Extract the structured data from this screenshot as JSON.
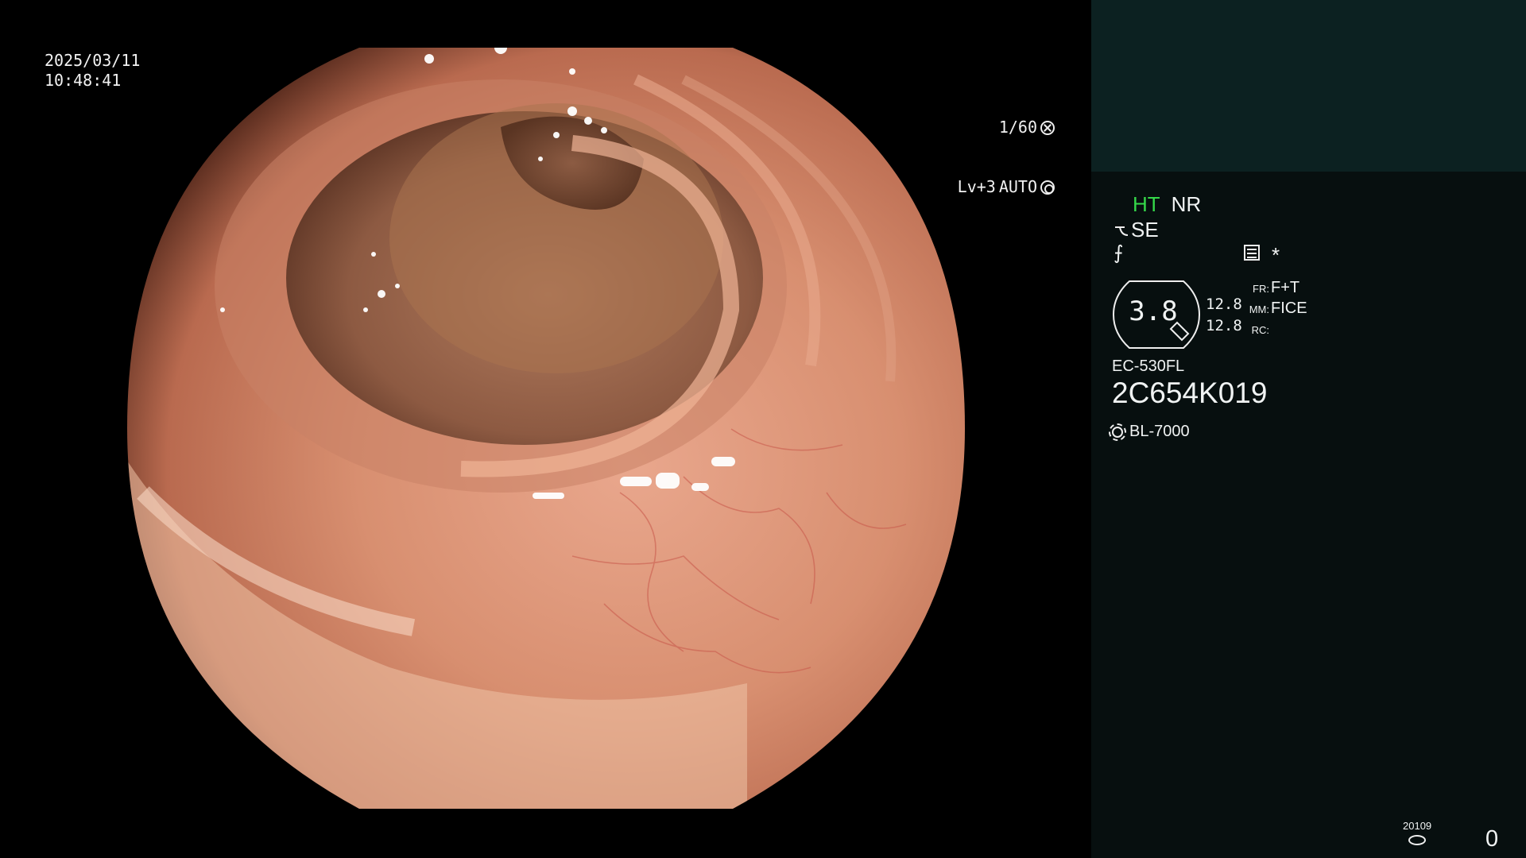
{
  "overlay": {
    "date": "2025/03/11",
    "time": "10:48:41",
    "shutter": "1/60",
    "exposure_level": "Lv+3",
    "iris_mode": "AUTO"
  },
  "icons": {
    "shutter": "aperture-icon",
    "iris": "iris-icon",
    "structure": "scope-bend-icon",
    "curve": "gamma-curve-icon",
    "menu": "menu-list-icon",
    "light": "light-source-icon",
    "storage": "disk-icon"
  },
  "panel": {
    "ht": "HT",
    "nr": "NR",
    "se": "SE",
    "curve_symbol": "⨍",
    "star": "*",
    "zoom": "3.8",
    "size_values": [
      "12.8",
      "12.8"
    ],
    "modes": [
      {
        "key": "FR:",
        "value": "F+T"
      },
      {
        "key": "MM:",
        "value": "FICE"
      },
      {
        "key": "RC:",
        "value": ""
      }
    ],
    "scope_model": "EC-530FL",
    "scope_serial": "2C654K019",
    "light_source": "BL-7000",
    "counter_label": "20109",
    "counter_value": "0"
  },
  "colors": {
    "ht_accent": "#35d84a",
    "panel_top": "#0c2121",
    "panel_bg": "#070f0f"
  }
}
